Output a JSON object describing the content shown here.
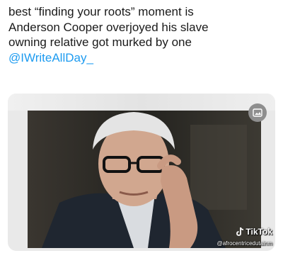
{
  "post": {
    "lines": [
      "best “finding your roots” moment is",
      "Anderson Cooper overjoyed his slave",
      "owning relative got murked by one"
    ],
    "mention": "@IWriteAllDay_"
  },
  "media": {
    "watermark_brand": "TikTok",
    "watermark_handle": "@afrocentricedutainm"
  },
  "colors": {
    "mention": "#1d9bf0",
    "text": "#1a1a1a"
  }
}
